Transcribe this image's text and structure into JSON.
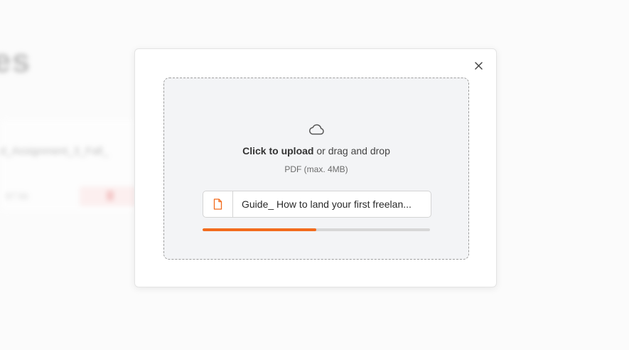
{
  "background": {
    "title": "es",
    "file_name": "d_Assignment_3_Fall_",
    "file_size": "67 kb"
  },
  "upload_modal": {
    "close_icon": "close-icon",
    "cloud_icon": "cloud-icon",
    "cta_bold": "Click to upload",
    "cta_rest": " or drag and drop",
    "hint": "PDF (max. 4MB)",
    "file": {
      "icon": "file-icon",
      "name": "Guide_ How to land your first freelan..."
    },
    "progress": 0.5,
    "accent_color": "#f26b1d"
  }
}
